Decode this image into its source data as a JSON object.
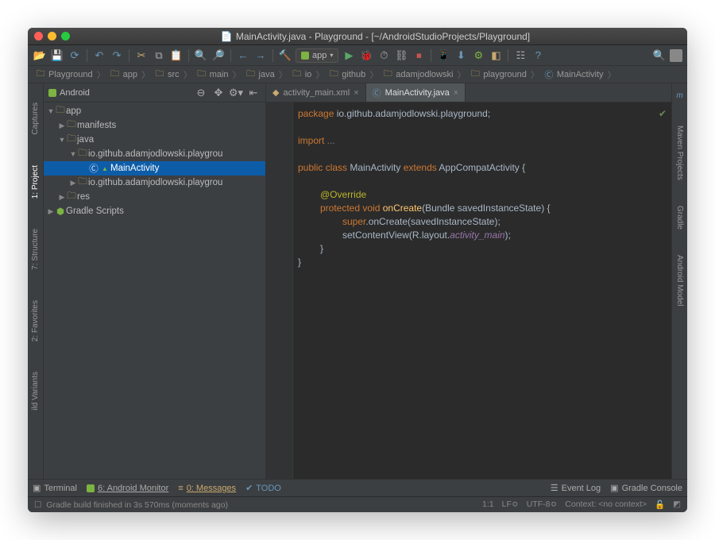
{
  "window": {
    "title": "MainActivity.java - Playground - [~/AndroidStudioProjects/Playground]"
  },
  "runconfig": {
    "label": "app"
  },
  "breadcrumbs": [
    "Playground",
    "app",
    "src",
    "main",
    "java",
    "io",
    "github",
    "adamjodlowski",
    "playground",
    "MainActivity"
  ],
  "sidebar": {
    "view": "Android",
    "tree": {
      "app": "app",
      "manifests": "manifests",
      "java": "java",
      "pkg1": "io.github.adamjodlowski.playgrou",
      "main": "MainActivity",
      "pkg2": "io.github.adamjodlowski.playgrou",
      "res": "res",
      "gradle": "Gradle Scripts"
    }
  },
  "leftTabs": {
    "captures": "Captures",
    "project": "1: Project",
    "structure": "7: Structure",
    "favorites": "2: Favorites",
    "variants": "ild Variants"
  },
  "rightTabs": {
    "maven": "Maven Projects",
    "gradle": "Gradle",
    "model": "Android Model"
  },
  "tabs": {
    "xml": "activity_main.xml",
    "java": "MainActivity.java"
  },
  "code": {
    "l1a": "package",
    "l1b": " io.github.adamjodlowski.playground;",
    "l2a": "import",
    "l2b": " ...",
    "l3a": "public class",
    "l3b": " MainActivity ",
    "l3c": "extends",
    "l3d": " AppCompatActivity {",
    "l4": "@Override",
    "l5a": "protected void",
    "l5b": " onCreate",
    "l5c": "(Bundle savedInstanceState) {",
    "l6a": "super",
    "l6b": ".onCreate(savedInstanceState);",
    "l7a": "setContentView(R.layout.",
    "l7b": "activity_main",
    "l7c": ");",
    "l8": "}",
    "l9": "}"
  },
  "bottom": {
    "terminal": "Terminal",
    "monitor": "6: Android Monitor",
    "messages": "0: Messages",
    "todo": "TODO",
    "eventlog": "Event Log",
    "gradleconsole": "Gradle Console"
  },
  "status": {
    "msg": "Gradle build finished in 3s 570ms (moments ago)",
    "pos": "1:1",
    "le": "LF≎",
    "enc": "UTF-8≎",
    "ctx": "Context: <no context>"
  }
}
